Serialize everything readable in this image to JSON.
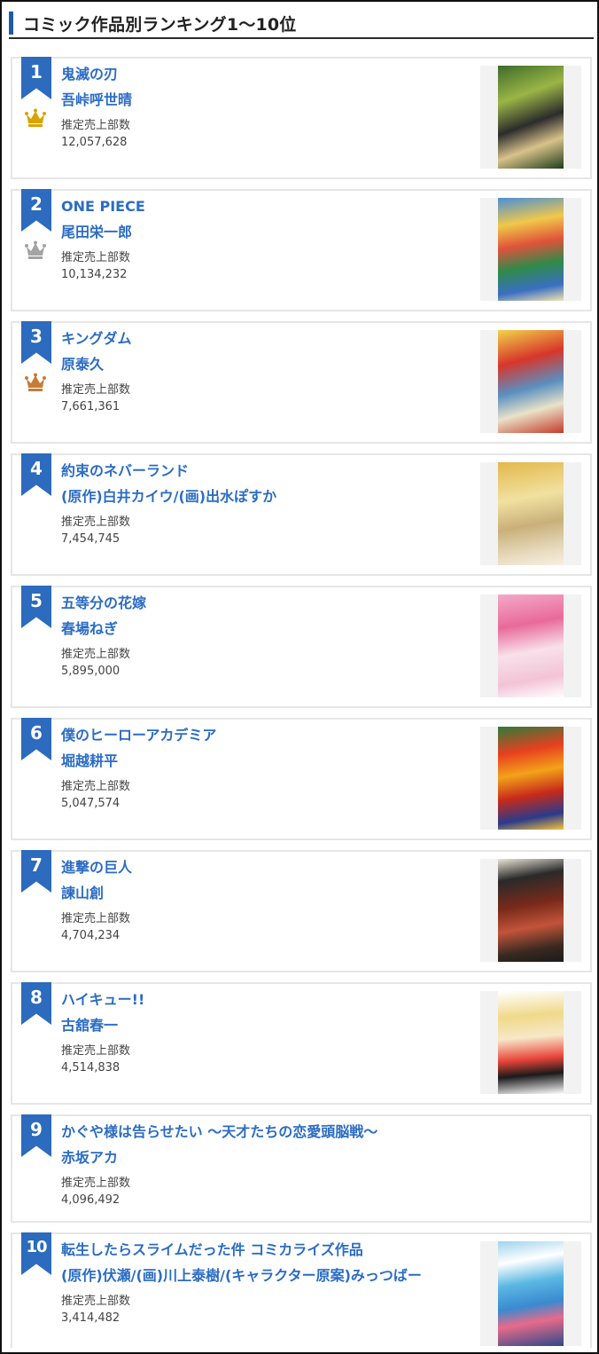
{
  "header": {
    "title": "コミック作品別ランキング1〜10位"
  },
  "colors": {
    "accent": "#2b6cc4",
    "ribbon": "#2c6bbd",
    "gold": "#d9a300",
    "silver": "#a3a3a3",
    "bronze": "#c77c35"
  },
  "sales_label": "推定売上部数",
  "rankings": [
    {
      "rank": "1",
      "title": "鬼滅の刃",
      "author": "吾峠呼世晴",
      "label": "推定売上部数",
      "sales": "12,057,628",
      "crown": "gold-crown-icon"
    },
    {
      "rank": "2",
      "title": "ONE PIECE",
      "author": "尾田栄一郎",
      "label": "推定売上部数",
      "sales": "10,134,232",
      "crown": "silver-crown-icon"
    },
    {
      "rank": "3",
      "title": "キングダム",
      "author": "原泰久",
      "label": "推定売上部数",
      "sales": "7,661,361",
      "crown": "bronze-crown-icon"
    },
    {
      "rank": "4",
      "title": "約束のネバーランド",
      "author": "(原作)白井カイウ/(画)出水ぽすか",
      "label": "推定売上部数",
      "sales": "7,454,745"
    },
    {
      "rank": "5",
      "title": "五等分の花嫁",
      "author": "春場ねぎ",
      "label": "推定売上部数",
      "sales": "5,895,000"
    },
    {
      "rank": "6",
      "title": "僕のヒーローアカデミア",
      "author": "堀越耕平",
      "label": "推定売上部数",
      "sales": "5,047,574"
    },
    {
      "rank": "7",
      "title": "進撃の巨人",
      "author": "諫山創",
      "label": "推定売上部数",
      "sales": "4,704,234"
    },
    {
      "rank": "8",
      "title": "ハイキュー!!",
      "author": "古舘春一",
      "label": "推定売上部数",
      "sales": "4,514,838"
    },
    {
      "rank": "9",
      "title": "かぐや様は告らせたい 〜天才たちの恋愛頭脳戦〜",
      "author": "赤坂アカ",
      "label": "推定売上部数",
      "sales": "4,096,492"
    },
    {
      "rank": "10",
      "title": "転生したらスライムだった件 コミカライズ作品",
      "author": "(原作)伏瀬/(画)川上泰樹/(キャラクター原案)みっつばー",
      "label": "推定売上部数",
      "sales": "3,414,482"
    }
  ]
}
